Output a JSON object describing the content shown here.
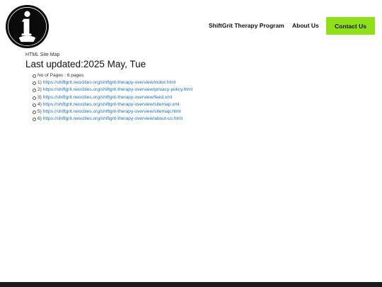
{
  "header": {
    "logo_icon": "info-logo-icon",
    "nav": [
      {
        "label": "ShiftGrit Therapy Program"
      },
      {
        "label": "About Us"
      }
    ],
    "contact_label": "Contact Us",
    "contact_color": "#8ee019"
  },
  "main": {
    "sitemap_label": "HTML Site Map",
    "updated": "Last updated:2025 May, Tue",
    "pages_count": "No of Pages : 6 pages",
    "links": [
      {
        "index": "1)",
        "url": "https://shiftgrit.neocities.org/shiftgrit-therapy-overview/index.html"
      },
      {
        "index": "2)",
        "url": "https://shiftgrit.neocities.org/shiftgrit-therapy-overview/privacy-policy.html"
      },
      {
        "index": "3)",
        "url": "https://shiftgrit.neocities.org/shiftgrit-therapy-overview/feed.xml"
      },
      {
        "index": "4)",
        "url": "https://shiftgrit.neocities.org/shiftgrit-therapy-overview/sitemap.xml"
      },
      {
        "index": "5)",
        "url": "https://shiftgrit.neocities.org/shiftgrit-therapy-overview/sitemap.html"
      },
      {
        "index": "6)",
        "url": "https://shiftgrit.neocities.org/shiftgrit-therapy-overview/about-us.html"
      }
    ]
  }
}
